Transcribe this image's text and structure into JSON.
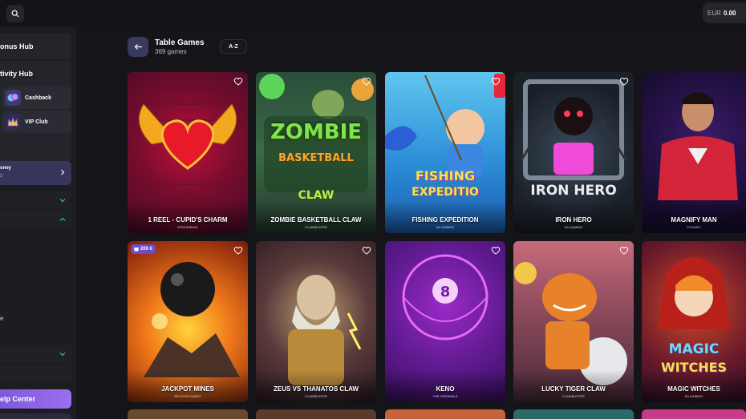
{
  "topbar": {
    "search_icon": "search-icon",
    "balance_currency": "EUR",
    "balance_amount": "0.00"
  },
  "sidebar": {
    "bonus_hub": "onus Hub",
    "activity_hub": "tivity Hub",
    "cashback": "Cashback",
    "vip_club": "VIP Club",
    "money_item": "oney",
    "money_sub": "2",
    "stray_text": "e",
    "help_center": "elp Center"
  },
  "header": {
    "title": "Table Games",
    "count": "369 games",
    "sort_label": "A-Z"
  },
  "games": [
    {
      "name": "1 REEL - CUPID'S CHARM",
      "provider": "SPINOMENAL",
      "badge": ""
    },
    {
      "name": "ZOMBIE BASKETBALL CLAW",
      "provider": "CLAWBUSTER",
      "badge": ""
    },
    {
      "name": "FISHING EXPEDITION",
      "provider": "KA GAMING",
      "badge": ""
    },
    {
      "name": "IRON HERO",
      "provider": "KA GAMING",
      "badge": ""
    },
    {
      "name": "MAGNIFY MAN",
      "provider": "FUGASO",
      "badge": ""
    },
    {
      "name": "JACKPOT MINES",
      "provider": "BELATRA GAMES",
      "badge": "200 €"
    },
    {
      "name": "ZEUS VS THANATOS CLAW",
      "provider": "CLAWBUSTER",
      "badge": ""
    },
    {
      "name": "KENO",
      "provider": "THE ORIGINALS",
      "badge": ""
    },
    {
      "name": "LUCKY TIGER CLAW",
      "provider": "CLAWBUSTER",
      "badge": ""
    },
    {
      "name": "MAGIC WITCHES",
      "provider": "KA GAMING",
      "badge": ""
    }
  ],
  "art_text": {
    "zombie_1": "ZOMBIE",
    "zombie_2": "BASKETBALL",
    "zombie_3": "CLAW",
    "fishing_1": "FISHING",
    "fishing_2": "EXPEDITIO",
    "iron": "IRON HERO",
    "magic_1": "MAGIC",
    "magic_2": "WITCHES"
  },
  "colors": {
    "accent": "#8a63e6",
    "background": "#141419",
    "sidebar": "#1c1c22"
  }
}
